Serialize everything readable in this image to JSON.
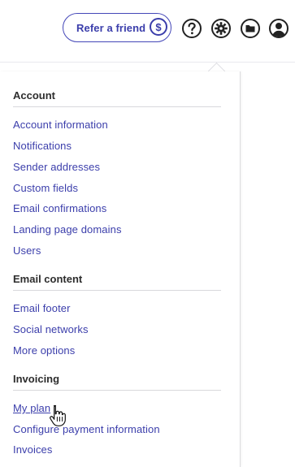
{
  "header": {
    "refer_label": "Refer a friend",
    "refer_icon": "$",
    "icons": [
      "help-icon",
      "gear-icon",
      "folder-icon",
      "user-icon"
    ]
  },
  "menu": {
    "account": {
      "title": "Account",
      "items": [
        "Account information",
        "Notifications",
        "Sender addresses",
        "Custom fields",
        "Email confirmations",
        "Landing page domains",
        "Users"
      ]
    },
    "email_content": {
      "title": "Email content",
      "items": [
        "Email footer",
        "Social networks",
        "More options"
      ]
    },
    "invoicing": {
      "title": "Invoicing",
      "items": [
        "My plan",
        "Configure payment information",
        "Invoices"
      ]
    }
  },
  "colors": {
    "accent": "#3b3eab",
    "text": "#2d2d2d",
    "divider": "#d8d8dc"
  }
}
